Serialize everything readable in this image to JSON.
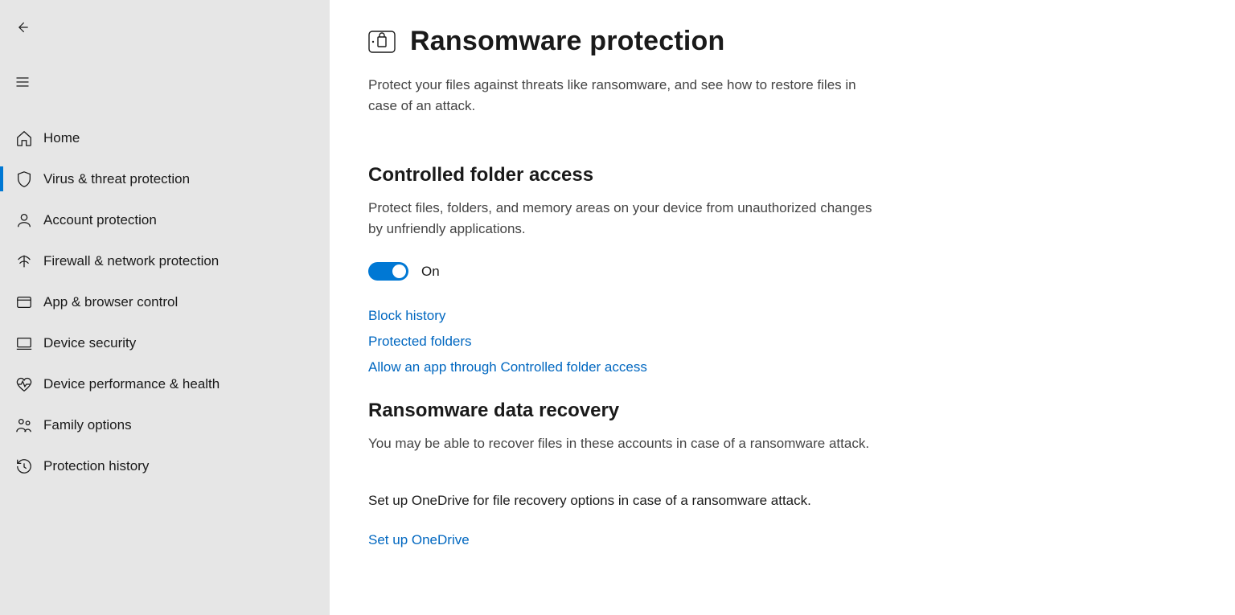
{
  "sidebar": {
    "items": [
      {
        "label": "Home"
      },
      {
        "label": "Virus & threat protection"
      },
      {
        "label": "Account protection"
      },
      {
        "label": "Firewall & network protection"
      },
      {
        "label": "App & browser control"
      },
      {
        "label": "Device security"
      },
      {
        "label": "Device performance & health"
      },
      {
        "label": "Family options"
      },
      {
        "label": "Protection history"
      }
    ]
  },
  "page": {
    "title": "Ransomware protection",
    "description": "Protect your files against threats like ransomware, and see how to restore files in case of an attack."
  },
  "controlled_folder": {
    "heading": "Controlled folder access",
    "description": "Protect files, folders, and memory areas on your device from unauthorized changes by unfriendly applications.",
    "toggle_label": "On",
    "links": {
      "block_history": "Block history",
      "protected_folders": "Protected folders",
      "allow_app": "Allow an app through Controlled folder access"
    }
  },
  "recovery": {
    "heading": "Ransomware data recovery",
    "description": "You may be able to recover files in these accounts in case of a ransomware attack.",
    "onedrive_text": "Set up OneDrive for file recovery options in case of a ransomware attack.",
    "onedrive_link": "Set up OneDrive"
  }
}
